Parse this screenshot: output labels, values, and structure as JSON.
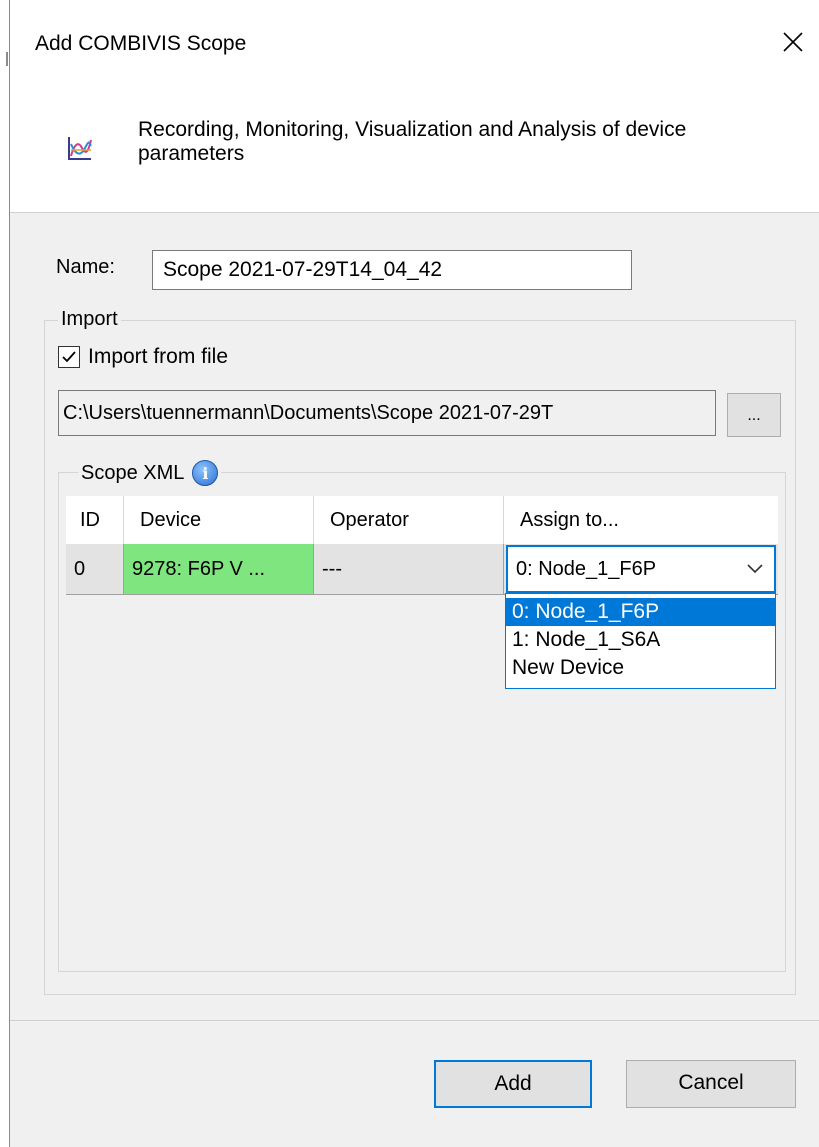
{
  "dialog": {
    "title": "Add COMBIVIS Scope",
    "description": "Recording, Monitoring, Visualization and Analysis of device parameters",
    "header_icon": "scope-chart-icon",
    "close_icon": "close-icon"
  },
  "name_field": {
    "label": "Name:",
    "value": "Scope 2021-07-29T14_04_42"
  },
  "import_group": {
    "legend": "Import",
    "import_from_file": {
      "label": "Import from file",
      "checked": true
    },
    "file_path": "C:\\Users\\tuennermann\\Documents\\Scope 2021-07-29T",
    "browse_label": "..."
  },
  "scope_xml": {
    "legend": "Scope XML",
    "info_icon": "i",
    "columns": [
      "ID",
      "Device",
      "Operator",
      "Assign to..."
    ],
    "rows": [
      {
        "id": "0",
        "device": "9278: F6P V ...",
        "operator": "---",
        "assign_to": "0: Node_1_F6P"
      }
    ],
    "device_cell_color": "#7fe57f",
    "assign_options": [
      "0: Node_1_F6P",
      "1: Node_1_S6A",
      "New Device"
    ],
    "selected_option_index": 0
  },
  "buttons": {
    "add": "Add",
    "cancel": "Cancel"
  },
  "colors": {
    "accent": "#0078d7",
    "window_bg": "#f0f0f0"
  }
}
